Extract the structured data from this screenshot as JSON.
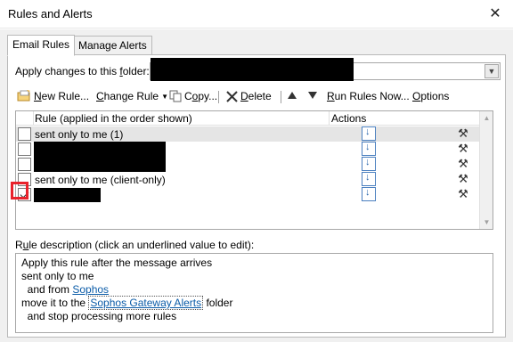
{
  "window": {
    "title": "Rules and Alerts",
    "close_glyph": "✕"
  },
  "tabs": [
    {
      "label": "Email Rules",
      "active": true
    },
    {
      "label": "Manage Alerts",
      "active": false
    }
  ],
  "folder": {
    "label_pre": "Apply changes to this ",
    "label_accel": "f",
    "label_post": "older:",
    "dropdown_icon": "chevron-down-icon"
  },
  "toolbar": {
    "new_rule": {
      "accel": "N",
      "rest": "ew Rule...",
      "icon": "new-rule-icon"
    },
    "change_rule": {
      "accel": "C",
      "pre": "",
      "rest": "hange Rule",
      "icon": "none"
    },
    "copy": {
      "pre": "C",
      "accel": "o",
      "rest": "py...",
      "icon": "copy-icon"
    },
    "delete": {
      "accel": "D",
      "rest": "elete",
      "icon": "delete-icon"
    },
    "move_up_icon": "move-up-icon",
    "move_down_icon": "move-down-icon",
    "run_rules": {
      "accel": "R",
      "rest": "un Rules Now...",
      "icon": "none"
    },
    "options": {
      "accel": "O",
      "rest": "ptions",
      "icon": "none"
    }
  },
  "rules_table": {
    "col_rule": "Rule (applied in the order shown)",
    "col_actions": "Actions",
    "rows": [
      {
        "name": "sent only to me (1)",
        "checked": false,
        "selected": true,
        "redacted": false
      },
      {
        "name": "",
        "checked": false,
        "selected": false,
        "redacted": true
      },
      {
        "name": "",
        "checked": false,
        "selected": false,
        "redacted": true
      },
      {
        "name": "sent only to me  (client-only)",
        "checked": false,
        "selected": false,
        "redacted": false
      },
      {
        "name": "",
        "checked": true,
        "selected": false,
        "redacted": true
      }
    ],
    "action_icons": [
      "move-to-folder-icon",
      "stop-processing-icon"
    ]
  },
  "description": {
    "label_pre": "R",
    "label_accel": "u",
    "label_post": "le description (click an underlined value to edit):",
    "line1": "Apply this rule after the message arrives",
    "line2": "sent only to me",
    "line3_pre": "  and from ",
    "line3_link": "Sophos",
    "line4_pre": "move it to the ",
    "line4_link": "Sophos Gateway Alerts",
    "line4_post": " folder",
    "line5": "  and stop processing more rules"
  },
  "colors": {
    "highlight": "#e8232c",
    "link": "#0b5ca8",
    "selected_row": "#e5e5e5"
  }
}
